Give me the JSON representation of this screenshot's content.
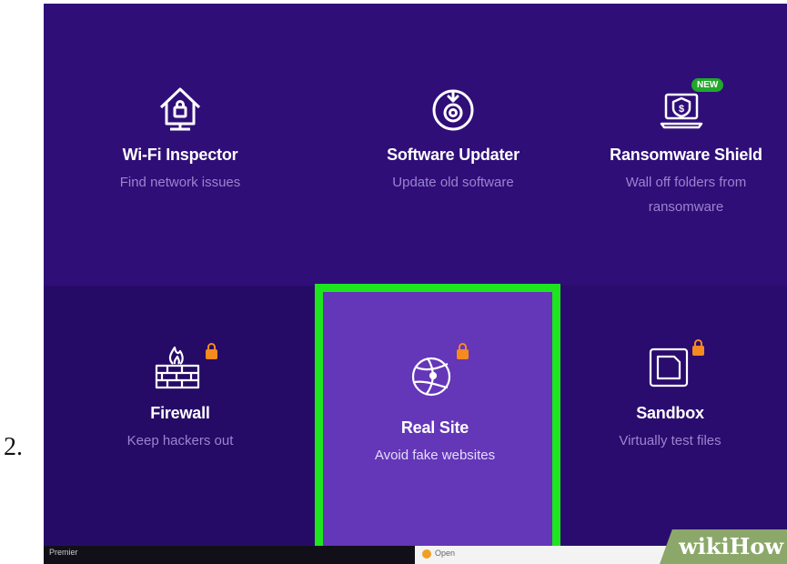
{
  "step_number": "2.",
  "tiles": {
    "wifi": {
      "title": "Wi-Fi Inspector",
      "subtitle": "Find network issues",
      "icon": "home-wifi-icon"
    },
    "updater": {
      "title": "Software Updater",
      "subtitle": "Update old software",
      "icon": "updater-disc-icon"
    },
    "ransomware": {
      "title": "Ransomware Shield",
      "subtitle_line1": "Wall off folders from",
      "subtitle_line2": "ransomware",
      "badge": "NEW",
      "icon": "laptop-shield-icon"
    },
    "firewall": {
      "title": "Firewall",
      "subtitle": "Keep hackers out",
      "icon": "brick-wall-fire-icon",
      "locked": true
    },
    "realsite": {
      "title": "Real Site",
      "subtitle": "Avoid fake websites",
      "icon": "globe-icon",
      "locked": true,
      "highlighted": true
    },
    "sandbox": {
      "title": "Sandbox",
      "subtitle": "Virtually test files",
      "icon": "sandbox-box-icon",
      "locked": true
    }
  },
  "taskbar": {
    "left_label": "Premier",
    "right_label": "Open"
  },
  "watermark": "wikiHow",
  "colors": {
    "background": "#2f0e78",
    "highlight_tile": "#6436b8",
    "highlight_border": "#1ee61e",
    "lock": "#f58a1f",
    "new_badge": "#21a82a"
  }
}
